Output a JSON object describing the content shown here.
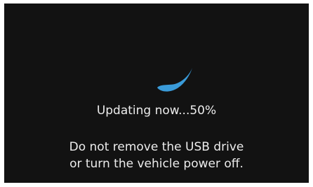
{
  "update_screen": {
    "status": "Updating now...50%",
    "progress_percent": 50,
    "warning_line_1": "Do not remove the USB drive",
    "warning_line_2": "or turn the vehicle power off.",
    "spinner_icon": "loading-arc-icon",
    "colors": {
      "background": "#121212",
      "text": "#ececec",
      "spinner": "#3a9bd9"
    }
  }
}
